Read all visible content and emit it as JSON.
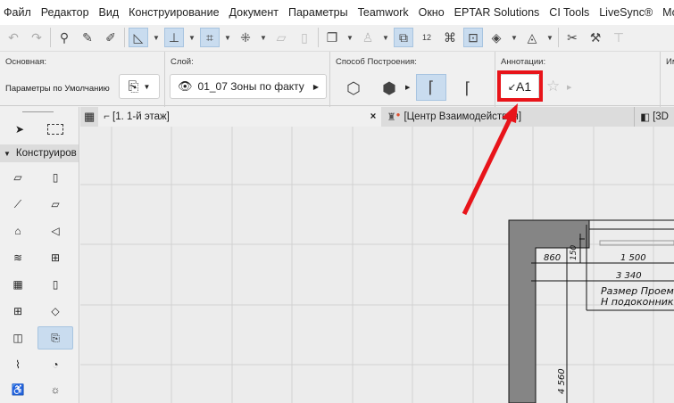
{
  "menu": [
    "Файл",
    "Редактор",
    "Вид",
    "Конструирование",
    "Документ",
    "Параметры",
    "Teamwork",
    "Окно",
    "EPTAR Solutions",
    "CI Tools",
    "LiveSync®",
    "Mo"
  ],
  "infobox": {
    "main_label": "Основная:",
    "main_value": "Параметры по Умолчанию",
    "layer_label": "Слой:",
    "layer_value": "01_07 Зоны по факту",
    "method_label": "Способ Построения:",
    "annot_label": "Аннотации:",
    "annot_button": "A1",
    "next_label": "Им"
  },
  "tabs": [
    {
      "label": "[1. 1-й этаж]",
      "close": "×"
    },
    {
      "label": "[Центр Взаимодействия]"
    },
    {
      "label": "[3D"
    }
  ],
  "toolbox": {
    "group_label": "Конструиров"
  },
  "drawing": {
    "dims": [
      "860",
      "150",
      "1 500",
      "3 340",
      "4 560"
    ],
    "label_line1": "Размер Проема",
    "label_line2": "Н подоконника"
  },
  "colors": {
    "highlight": "#e8141a",
    "selected": "#c9dcef",
    "wall": "#858585"
  }
}
